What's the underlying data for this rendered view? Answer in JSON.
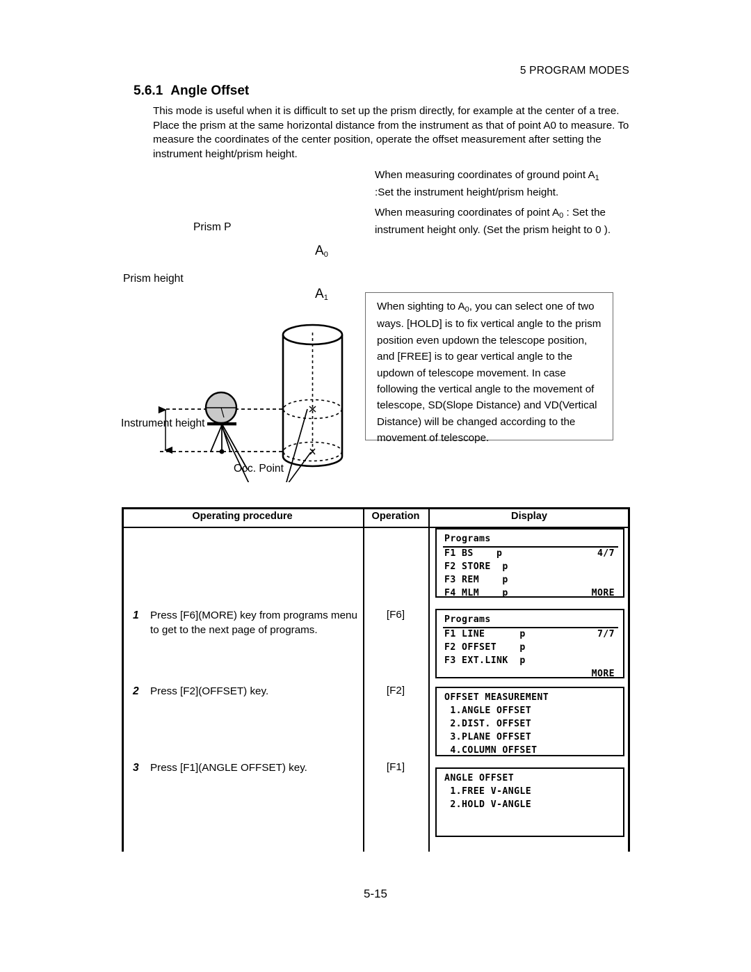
{
  "header": {
    "running_head": "5 PROGRAM MODES"
  },
  "section": {
    "number": "5.6.1",
    "title": "Angle Offset",
    "intro": "This mode is useful when it is difficult to set up the prism directly, for example at the center of a tree. Place the prism at the same horizontal distance from the instrument as that of point A0 to measure. To measure the coordinates of the center position, operate the offset measurement after setting the instrument height/prism height."
  },
  "right_notes": {
    "block1_line1_pre": "When measuring coordinates of ground point A",
    "block1_line1_sub": "1",
    "block1_line2": ":Set the instrument height/prism height.",
    "block2_pre": "When measuring  coordinates  of point A",
    "block2_sub": "0",
    "block2_post": " : Set the instrument height only. (Set the prism height to 0 )."
  },
  "note_box": {
    "text_pre": "When sighting to A",
    "text_sub": "0",
    "text_post": ", you can select one of two ways. [HOLD] is to fix vertical angle to the prism position even updown the telescope position, and [FREE] is to gear vertical angle to the updown of telescope movement. In case following the vertical angle to the movement of telescope, SD(Slope Distance) and VD(Vertical Distance) will be changed according to the movement of telescope."
  },
  "diagram": {
    "labels": {
      "prism_p": "Prism P",
      "prism_height": "Prism height",
      "instrument_height": "Instrument height",
      "occ_point": "Occ. Point",
      "a0": "A",
      "a0_sub": "0",
      "a1": "A",
      "a1_sub": "1"
    },
    "colors": {
      "fill_gray": "#c9c9c9",
      "stroke": "#000000"
    }
  },
  "table": {
    "headers": {
      "procedure": "Operating procedure",
      "operation": "Operation",
      "display": "Display"
    },
    "steps": [
      {
        "number": "1",
        "text": "Press [F6](MORE) key from programs menu to get to the next page of programs.",
        "operation": "[F6]"
      },
      {
        "number": "2",
        "text": "Press [F2](OFFSET) key.",
        "operation": "[F2]"
      },
      {
        "number": "3",
        "text": "Press [F1](ANGLE OFFSET) key.",
        "operation": "[F1]"
      }
    ],
    "displays": [
      {
        "title": "Programs",
        "has_rule": true,
        "rows": [
          {
            "left": "F1 BS    p",
            "right": "4/7"
          },
          {
            "left": "F2 STORE  p",
            "right": ""
          },
          {
            "left": "F3 REM    p",
            "right": ""
          },
          {
            "left": "F4 MLM    p",
            "right": "MORE"
          }
        ]
      },
      {
        "title": "Programs",
        "has_rule": true,
        "rows": [
          {
            "left": "F1 LINE      p",
            "right": "7/7"
          },
          {
            "left": "F2 OFFSET    p",
            "right": ""
          },
          {
            "left": "F3 EXT.LINK  p",
            "right": ""
          },
          {
            "left": "",
            "right": "MORE"
          }
        ]
      },
      {
        "title": "OFFSET MEASUREMENT",
        "has_rule": false,
        "rows": [
          {
            "left": " 1.ANGLE OFFSET",
            "right": ""
          },
          {
            "left": " 2.DIST. OFFSET",
            "right": ""
          },
          {
            "left": " 3.PLANE OFFSET",
            "right": ""
          },
          {
            "left": " 4.COLUMN OFFSET",
            "right": ""
          }
        ]
      },
      {
        "title": "ANGLE OFFSET",
        "has_rule": false,
        "rows": [
          {
            "left": " 1.FREE V-ANGLE",
            "right": ""
          },
          {
            "left": " 2.HOLD V-ANGLE",
            "right": ""
          },
          {
            "left": "",
            "right": ""
          },
          {
            "left": "",
            "right": ""
          }
        ]
      }
    ]
  },
  "footer": {
    "page_number": "5-15"
  }
}
